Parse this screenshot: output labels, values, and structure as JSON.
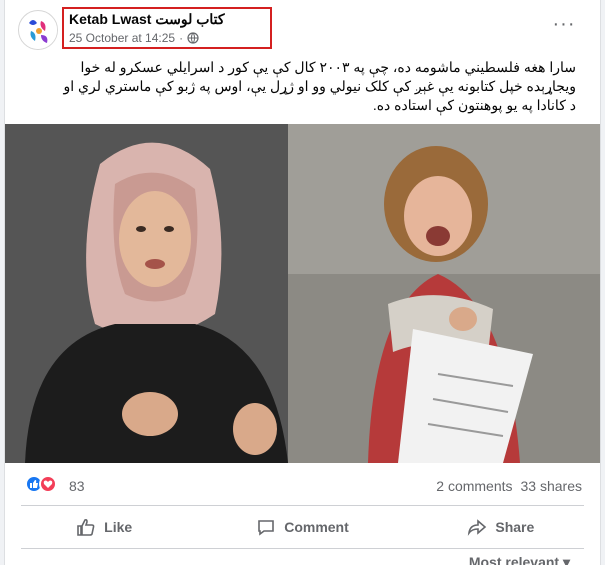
{
  "post": {
    "author": "Ketab Lwast كتاب لوست",
    "timestamp": "25 October at 14:25",
    "privacy_icon": "globe-icon",
    "more_icon": "more-horizontal-icon",
    "text_lines": [
      "سارا هغه فلسطيني ماشومه ده، چې په ۲۰۰۳ کال کې يې کور د اسرايلي عسکرو له خوا",
      "ويجاړېده خپل کتابونه يې غېږ کې کلک نيولي وو او ژړل يې، اوس په ژبو کې ماستري لري او",
      "د کانادا په يو پوهنتون کې استاده ده."
    ]
  },
  "reactions": {
    "icons": [
      "like-icon",
      "love-icon"
    ],
    "count": "83",
    "comments": "2 comments",
    "shares": "33 shares"
  },
  "actions": {
    "like": "Like",
    "comment": "Comment",
    "share": "Share"
  },
  "sort": {
    "label": "Most relevant"
  },
  "colors": {
    "highlight": "#d42020",
    "like_blue": "#1877f2",
    "love_red": "#f33e58",
    "meta_gray": "#65676b"
  }
}
